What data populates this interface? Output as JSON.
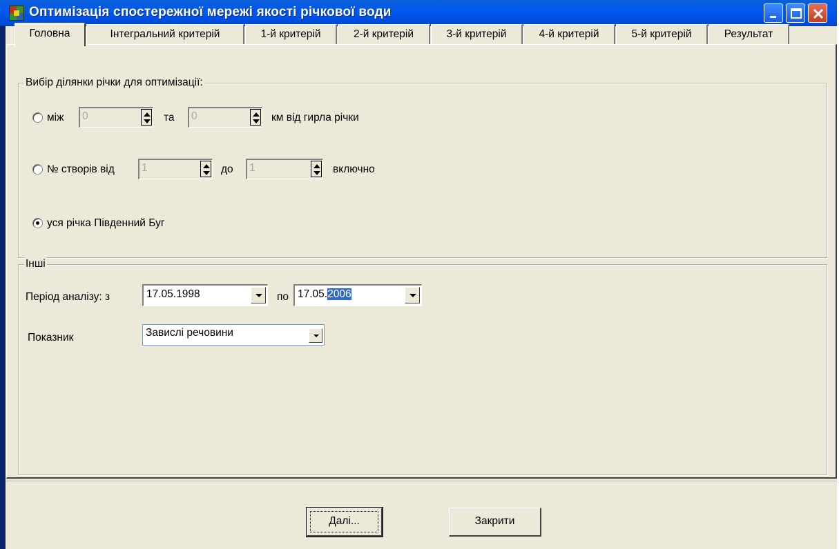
{
  "window": {
    "title": "Оптимізація спостережної мережі якості річкової води",
    "colors": {
      "titlebar": "#0058ee",
      "face": "#ece9d8",
      "selection": "#316ac5"
    }
  },
  "tabs": [
    {
      "label": "Головна",
      "active": true
    },
    {
      "label": "Інтегральний критерій"
    },
    {
      "label": "1-й критерій"
    },
    {
      "label": "2-й критерій"
    },
    {
      "label": "3-й критерій"
    },
    {
      "label": "4-й критерій"
    },
    {
      "label": "5-й критерій"
    },
    {
      "label": "Результат"
    }
  ],
  "section_select": {
    "legend": "Вибір ділянки річки для оптимізації:",
    "option_between": {
      "label": "між",
      "from": "0",
      "and_label": "та",
      "to": "0",
      "suffix": "км від гирла річки",
      "checked": false
    },
    "option_sites": {
      "label": "№ створів від",
      "from": "1",
      "to_label": "до",
      "to": "1",
      "suffix": "включно",
      "checked": false
    },
    "option_whole": {
      "label": "уся річка Південний Буг",
      "checked": true
    }
  },
  "other": {
    "legend": "Інші",
    "period_label": "Період аналізу: з",
    "period_from": "17.05.1998",
    "period_to_label": "по",
    "period_to_prefix": "17.05.",
    "period_to_selected": "2006",
    "indicator_label": "Показник",
    "indicator_value": "Завислі речовини"
  },
  "buttons": {
    "next": "Далі...",
    "close": "Закрити"
  }
}
